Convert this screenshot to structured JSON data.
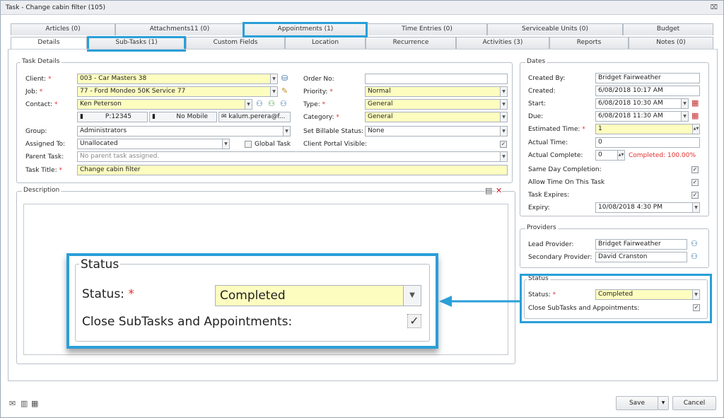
{
  "window": {
    "title": "Task - Change cabin filter (105)",
    "close_glyph": "⌧"
  },
  "tabs_top": [
    "Articles (0)",
    "Attachments11 (0)",
    "Appointments (1)",
    "Time Entries (0)",
    "Serviceable Units (0)",
    "Budget"
  ],
  "tabs_bottom": [
    "Details",
    "Sub-Tasks (1)",
    "Custom Fields",
    "Location",
    "Recurrence",
    "Activities (3)",
    "Reports",
    "Notes (0)"
  ],
  "task_details": {
    "legend": "Task Details",
    "client_label": "Client:",
    "client_value": "003 - Car Masters 38",
    "job_label": "Job:",
    "job_value": "77 - Ford Mondeo 50K Service 77",
    "contact_label": "Contact:",
    "contact_value": "Ken Peterson",
    "phone_value": "P:12345",
    "mobile_value": "No Mobile",
    "email_value": "kalum.perera@f...",
    "group_label": "Group:",
    "group_value": "Administrators",
    "assigned_label": "Assigned To:",
    "assigned_value": "Unallocated",
    "global_task_label": "Global Task",
    "parent_label": "Parent Task:",
    "parent_value": "No parent task assigned.",
    "title_label": "Task Title:",
    "title_value": "Change cabin filter",
    "order_label": "Order No:",
    "order_value": "",
    "priority_label": "Priority:",
    "priority_value": "Normal",
    "type_label": "Type:",
    "type_value": "General",
    "category_label": "Category:",
    "category_value": "General",
    "billable_label": "Set Billable Status:",
    "billable_value": "None",
    "portal_label": "Client Portal Visible:"
  },
  "description": {
    "legend": "Description"
  },
  "dates": {
    "legend": "Dates",
    "created_by_label": "Created By:",
    "created_by_value": "Bridget Fairweather",
    "created_label": "Created:",
    "created_value": "6/08/2018 10:17 AM",
    "start_label": "Start:",
    "start_value": "6/08/2018 10:30 AM",
    "due_label": "Due:",
    "due_value": "6/08/2018 11:30 AM",
    "est_label": "Estimated Time:",
    "est_value": "1",
    "actual_label": "Actual Time:",
    "actual_value": "0",
    "complete_label": "Actual Complete:",
    "complete_value": "0",
    "complete_status": "Completed: 100.00%",
    "sameday_label": "Same Day Completion:",
    "allowtime_label": "Allow Time On This Task",
    "expires_label": "Task Expires:",
    "expiry_label": "Expiry:",
    "expiry_value": "10/08/2018 4:30 PM"
  },
  "providers": {
    "legend": "Providers",
    "lead_label": "Lead Provider:",
    "lead_value": "Bridget Fairweather",
    "secondary_label": "Secondary Provider:",
    "secondary_value": "David Cranston"
  },
  "status": {
    "legend": "Status",
    "status_label": "Status:",
    "status_value": "Completed",
    "close_label": "Close SubTasks and Appointments:"
  },
  "footer": {
    "save_label": "Save",
    "cancel_label": "Cancel"
  },
  "colors": {
    "highlight": "#2a9fd8",
    "required": "#e03030",
    "field_yellow": "#fdfdc0"
  }
}
